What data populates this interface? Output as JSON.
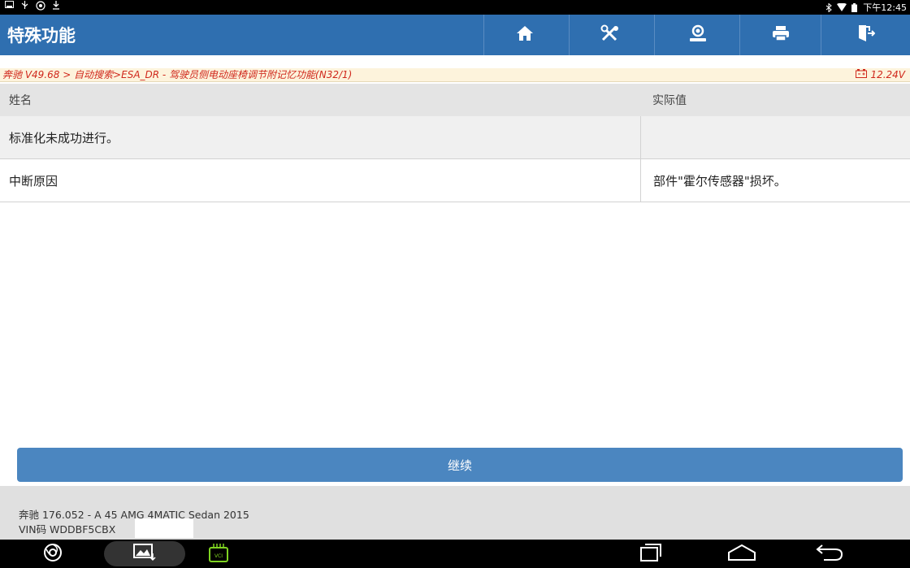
{
  "statusbar": {
    "left_icons": [
      "screenshot-icon",
      "usb-icon",
      "settings-icon",
      "download-icon"
    ],
    "time": "下午12:45"
  },
  "header": {
    "title": "特殊功能",
    "buttons": [
      "home-icon",
      "tools-icon",
      "support-icon",
      "print-icon",
      "exit-icon"
    ],
    "accent": "#2f6fb0"
  },
  "breadcrumb": {
    "path": "奔驰 V49.68 > 自动搜索>ESA_DR - 驾驶员侧电动座椅调节附记忆功能(N32/1)",
    "voltage": "12.24V"
  },
  "table": {
    "columns": [
      "姓名",
      "实际值"
    ],
    "rows": [
      [
        "标准化未成功进行。",
        ""
      ],
      [
        "中断原因",
        "部件\"霍尔传感器\"损坏。"
      ]
    ]
  },
  "actions": {
    "continue_label": "继续"
  },
  "footer": {
    "vehicle": "奔驰 176.052 - A 45 AMG 4MATIC Sedan 2015",
    "vin": "VIN码 WDDBF5CBX"
  },
  "navbar": {
    "vci_label": "VCI"
  }
}
